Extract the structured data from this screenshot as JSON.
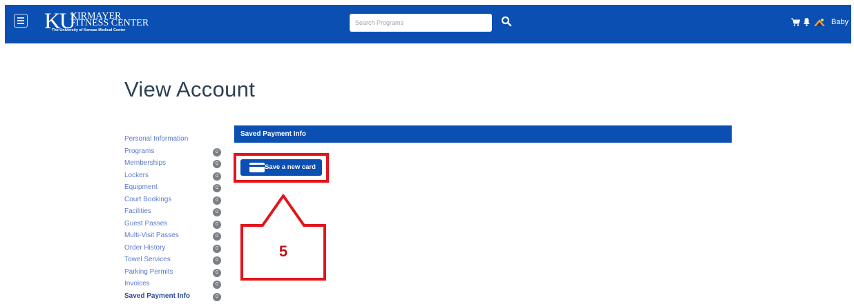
{
  "header": {
    "logo": {
      "mark": "KU",
      "line1": "KIRMAYER",
      "line2": "FITNESS CENTER",
      "subtitle": "The University of Kansas Medical Center"
    },
    "search": {
      "placeholder": "Search Programs",
      "value": ""
    },
    "icons": {
      "menu": "hamburger-menu-icon",
      "search": "search-icon",
      "cart": "cart-icon",
      "notifications": "bell-icon",
      "avatar": "avatar-image"
    },
    "username": "Baby"
  },
  "page": {
    "title": "View Account"
  },
  "sidebar": {
    "items": [
      {
        "label": "Personal Information",
        "badge": ""
      },
      {
        "label": "Programs",
        "badge": "0"
      },
      {
        "label": "Memberships",
        "badge": "0"
      },
      {
        "label": "Lockers",
        "badge": "0"
      },
      {
        "label": "Equipment",
        "badge": "0"
      },
      {
        "label": "Court Bookings",
        "badge": "0"
      },
      {
        "label": "Facilities",
        "badge": "0"
      },
      {
        "label": "Guest Passes",
        "badge": "0"
      },
      {
        "label": "Multi-Visit Passes",
        "badge": "0"
      },
      {
        "label": "Order History",
        "badge": "0"
      },
      {
        "label": "Towel Services",
        "badge": "0"
      },
      {
        "label": "Parking Permits",
        "badge": "0"
      },
      {
        "label": "Invoices",
        "badge": "0"
      },
      {
        "label": "Saved Payment Info",
        "badge": "0",
        "active": true
      }
    ]
  },
  "main": {
    "section_title": "Saved Payment Info",
    "save_card_label": "Save a new card"
  },
  "annotation": {
    "step": "5",
    "color": "#e3141b"
  },
  "colors": {
    "brand": "#0b4fb3",
    "link": "#5b7ac6",
    "badge": "#7a7f85"
  }
}
